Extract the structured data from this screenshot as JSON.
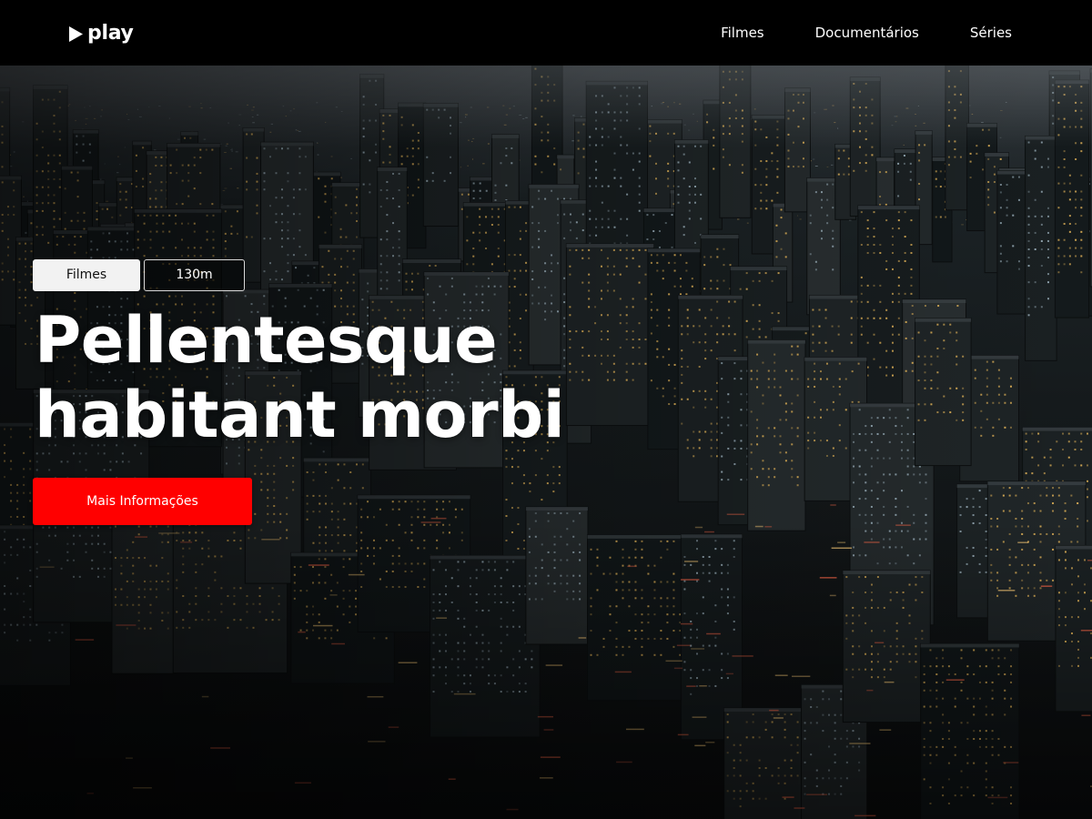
{
  "app": {
    "logo_text": "play",
    "logo_icon": "play-triangle-icon"
  },
  "nav": {
    "items": [
      {
        "label": "Filmes"
      },
      {
        "label": "Documentários"
      },
      {
        "label": "Séries"
      }
    ]
  },
  "hero": {
    "background": "night-city-aerial-photo",
    "tags": {
      "genre": "Filmes",
      "duration": "130m"
    },
    "title_line1": "Pellentesque",
    "title_line2": "habitant morbi",
    "cta_label": "Mais Informações"
  },
  "colors": {
    "navbar_bg": "#000000",
    "accent": "#ff0000",
    "text": "#ffffff",
    "tag_bg": "#f2f2f2"
  }
}
